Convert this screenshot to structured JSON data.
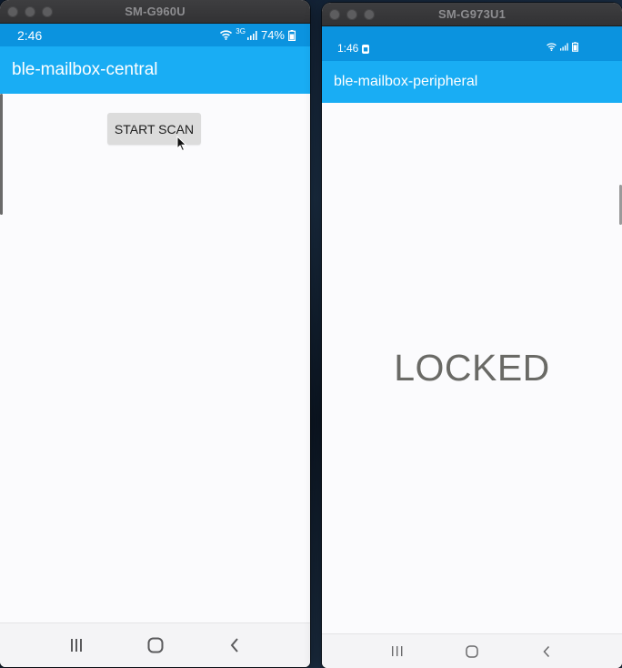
{
  "left_window": {
    "title": "SM-G960U",
    "status": {
      "time": "2:46",
      "network": "3G",
      "battery": "74%"
    },
    "app_title": "ble-mailbox-central",
    "scan_button_label": "START SCAN"
  },
  "right_window": {
    "title": "SM-G973U1",
    "status": {
      "time": "1:46"
    },
    "app_title": "ble-mailbox-peripheral",
    "lock_status": "LOCKED"
  },
  "colors": {
    "status_bar": "#0b93df",
    "app_bar": "#19adf4",
    "background": "#fbfbfd",
    "button": "#dcdcdc"
  },
  "icons": [
    "close-dot",
    "minimize-dot",
    "zoom-dot",
    "wifi-icon",
    "signal-icon",
    "battery-icon",
    "notification-icon",
    "recents-icon",
    "home-icon",
    "back-icon",
    "cursor-icon"
  ]
}
